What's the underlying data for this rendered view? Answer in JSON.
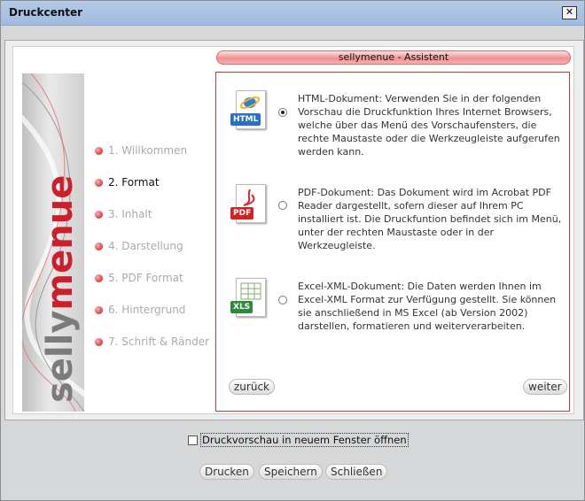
{
  "window": {
    "title": "Druckcenter",
    "close_glyph": "✕"
  },
  "wizard": {
    "header": "sellymenue - Assistent",
    "banner": {
      "part1": "selly",
      "part2": "menue"
    },
    "steps": [
      {
        "label": "1. Willkommen",
        "active": false
      },
      {
        "label": "2. Format",
        "active": true
      },
      {
        "label": "3. Inhalt",
        "active": false
      },
      {
        "label": "4. Darstellung",
        "active": false
      },
      {
        "label": "5. PDF Format",
        "active": false
      },
      {
        "label": "6. Hintergrund",
        "active": false
      },
      {
        "label": "7. Schrift & Ränder",
        "active": false
      }
    ],
    "options": [
      {
        "icon": "html-document-icon",
        "badge": "HTML",
        "selected": true,
        "text": "HTML-Dokument: Verwenden Sie in der folgenden Vorschau die Druckfunktion Ihres Internet Browsers, welche über das Menü des Vorschaufensters, die rechte Maustaste oder die Werkzeugleiste aufgerufen werden kann."
      },
      {
        "icon": "pdf-document-icon",
        "badge": "PDF",
        "selected": false,
        "text": "PDF-Dokument: Das Dokument wird im Acrobat PDF Reader dargestellt, sofern dieser auf Ihrem PC installiert ist. Die Druckfuntion befindet sich im Menü, unter der rechten Maustaste oder in der Werkzeugleiste."
      },
      {
        "icon": "excel-document-icon",
        "badge": "XLS",
        "selected": false,
        "text": "Excel-XML-Dokument: Die Daten werden Ihnen im Excel-XML Format zur Verfügung gestellt. Sie können sie anschließend in MS Excel (ab Version 2002) darstellen, formatieren und weiterverarbeiten."
      }
    ],
    "back_label": "zurück",
    "next_label": "weiter"
  },
  "preview_option": {
    "label": "Druckvorschau in neuem Fenster öffnen",
    "checked": false
  },
  "buttons": {
    "print": "Drucken",
    "save": "Speichern",
    "close": "Schließen"
  },
  "colors": {
    "accent": "#cc1f2b",
    "titlebar": "#a9c2e3"
  }
}
